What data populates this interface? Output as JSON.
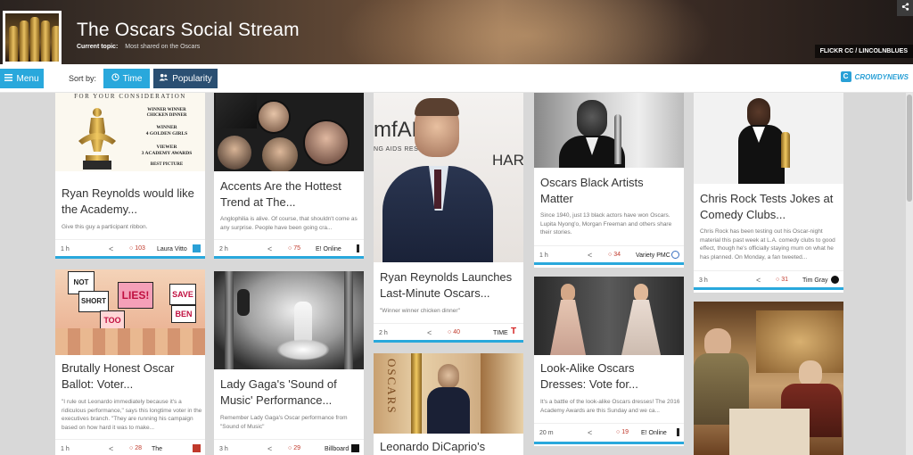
{
  "header": {
    "title": "The Oscars Social Stream",
    "topic_label": "Current topic:",
    "topic_value": "Most shared on the Oscars",
    "photo_credit": "FLICKR CC / LINCOLNBLUES",
    "share_icon": "share-icon"
  },
  "toolbar": {
    "menu_label": "Menu",
    "sort_label": "Sort by:",
    "time_label": "Time",
    "popularity_label": "Popularity",
    "brand": "CROWDYNEWS"
  },
  "cards": [
    {
      "title": "Ryan Reynolds would like the Academy...",
      "desc": "Give this guy a participant ribbon.",
      "time": "1 h",
      "comments": "103",
      "source": "Laura Vitto",
      "image_text": {
        "header": "FOR YOUR CONSIDERATION",
        "l1": "WINNER WINNER\nCHICKEN DINNER",
        "l2": "WINNER\n4 GOLDEN GIRLS",
        "l3": "VIEWER\n3 ACADEMY AWARDS",
        "l4": "BEST PICTURE"
      }
    },
    {
      "title": "Accents Are the Hottest Trend at The...",
      "desc": "Anglophilia is alive. Of course, that shouldn't come as any surprise. People have been going cra...",
      "time": "2 h",
      "comments": "75",
      "source": "E! Online"
    },
    {
      "title": "Ryan Reynolds Launches Last-Minute Oscars...",
      "desc": "\"Winner winner chicken dinner\"",
      "time": "2 h",
      "comments": "40",
      "source": "TIME",
      "image_text": {
        "left": "mfAR",
        "sub": "NG AIDS RESEARCH",
        "right": "HAR"
      }
    },
    {
      "title": "Oscars Black Artists Matter",
      "desc": "Since 1940, just 13 black actors have won Oscars. Lupita Nyong'o, Morgan Freeman and others share their stories.",
      "time": "1 h",
      "comments": "34",
      "source": "Variety PMC"
    },
    {
      "title": "Chris Rock Tests Jokes at Comedy Clubs...",
      "desc": "Chris Rock has been testing out his Oscar-night material this past week at L.A. comedy clubs to good effect, though he's officially staying mum on what he has planned. On Monday, a fan tweeted...",
      "time": "3 h",
      "comments": "31",
      "source": "Tim Gray"
    },
    {
      "title": "Brutally Honest Oscar Ballot: Voter...",
      "desc": "\"I rule out Leonardo immediately because it's a ridiculous performance,\" says this longtime voter in the executives branch. \"They are running his campaign based on how hard it was to make...",
      "time": "1 h",
      "comments": "28",
      "source": "The",
      "image_text": [
        "NOT",
        "SHORT",
        "LIES!",
        "SAVE",
        "TOO",
        "BEN"
      ]
    },
    {
      "title": "Lady Gaga's 'Sound of Music' Performance...",
      "desc": "Remember Lady Gaga's Oscar performance from \"Sound of Music\"",
      "time": "3 h",
      "comments": "29",
      "source": "Billboard"
    },
    {
      "title": "Leonardo DiCaprio's",
      "image_text": "OSCARS"
    },
    {
      "title": "Look-Alike Oscars Dresses: Vote for...",
      "desc": "It's a battle of the look-alike Oscars dresses! The 2016 Academy Awards are this Sunday and we ca...",
      "time": "20 m",
      "comments": "19",
      "source": "E! Online"
    },
    {}
  ],
  "colors": {
    "accent": "#29a8dc",
    "popularity_btn": "#2a4f72",
    "comment_red": "#c0392b"
  }
}
